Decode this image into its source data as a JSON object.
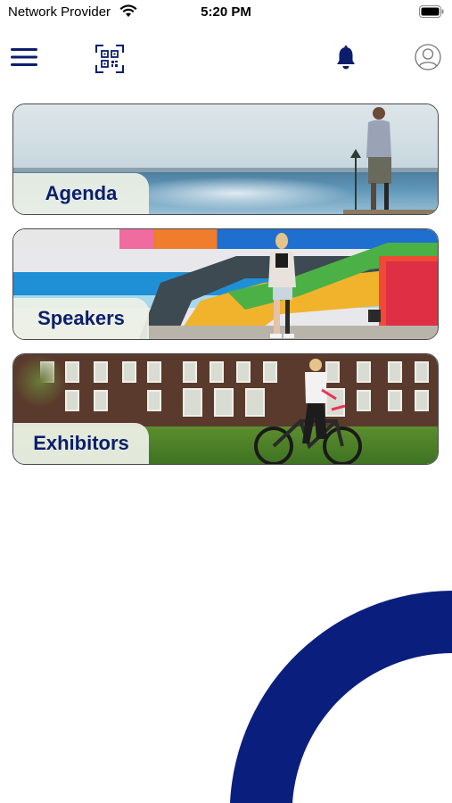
{
  "status_bar": {
    "carrier": "Network Provider",
    "time": "5:20 PM"
  },
  "nav": {
    "menu_icon": "hamburger-menu-icon",
    "qr_icon": "qr-code-scanner-icon",
    "bell_icon": "notification-bell-icon",
    "profile_icon": "user-profile-icon"
  },
  "cards": [
    {
      "label": "Agenda"
    },
    {
      "label": "Speakers"
    },
    {
      "label": "Exhibitors"
    }
  ],
  "colors": {
    "brand_navy": "#0b1e6b",
    "accent_navy": "#0a1f7d"
  }
}
